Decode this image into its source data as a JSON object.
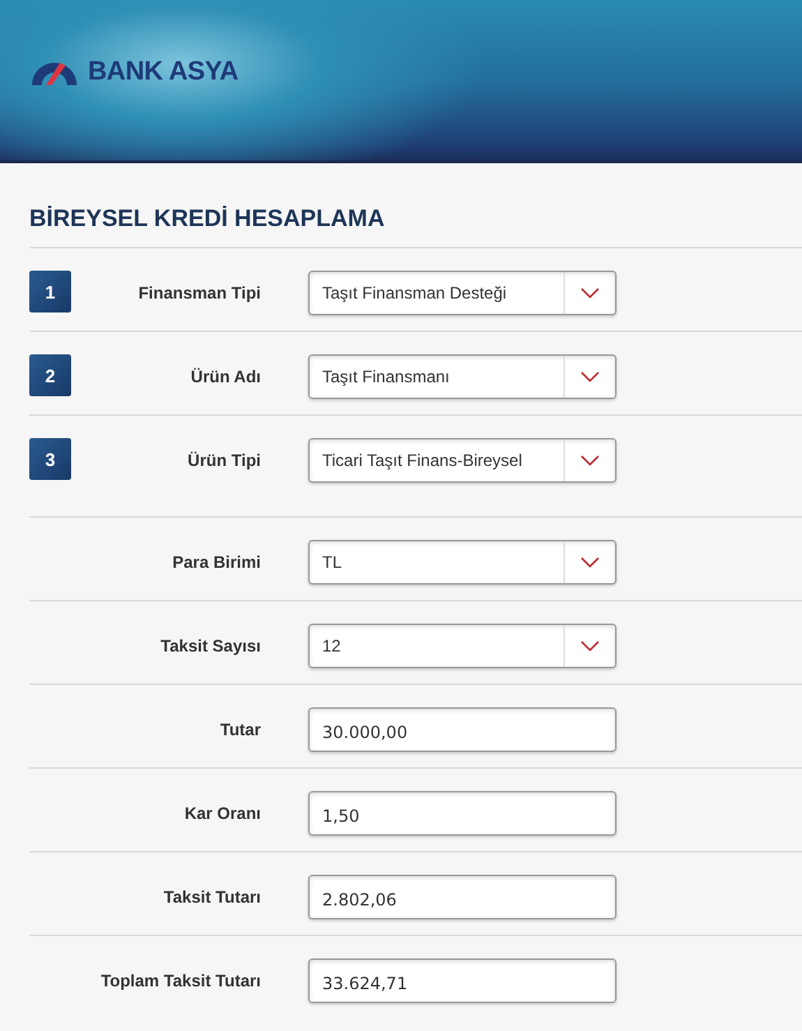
{
  "header": {
    "logo_text": "BANK ASYA"
  },
  "title": "BİREYSEL KREDİ HESAPLAMA",
  "rows": [
    {
      "step": "1",
      "label": "Finansman Tipi",
      "kind": "select",
      "value": "Taşıt Finansman Desteği"
    },
    {
      "step": "2",
      "label": "Ürün Adı",
      "kind": "select",
      "value": "Taşıt Finansmanı"
    },
    {
      "step": "3",
      "label": "Ürün Tipi",
      "kind": "select",
      "value": "Ticari Taşıt Finans-Bireysel"
    },
    {
      "label": "Para Birimi",
      "kind": "select",
      "value": "TL"
    },
    {
      "label": "Taksit Sayısı",
      "kind": "select",
      "value": "12"
    },
    {
      "label": "Tutar",
      "kind": "input",
      "value": "30.000,00"
    },
    {
      "label": "Kar Oranı",
      "kind": "input",
      "value": "1,50"
    },
    {
      "label": "Taksit Tutarı",
      "kind": "input",
      "value": "2.802,06"
    },
    {
      "label": "Toplam Taksit Tutarı",
      "kind": "input",
      "value": "33.624,71"
    }
  ]
}
